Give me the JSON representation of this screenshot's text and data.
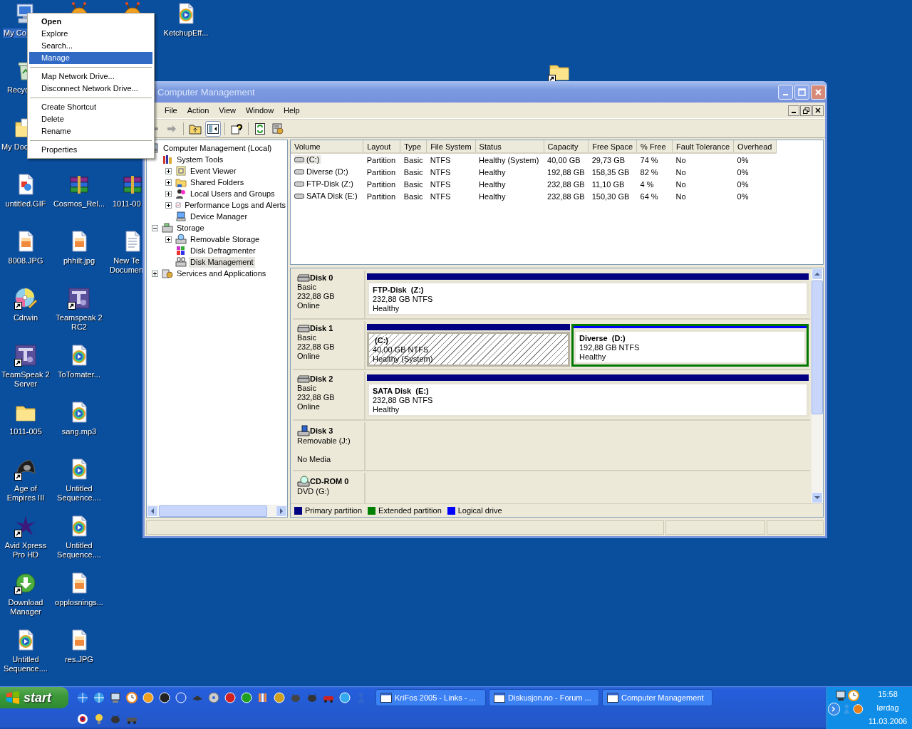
{
  "desktop": {
    "icons": [
      {
        "kind": "computer",
        "label": "My Co",
        "selected": true,
        "shortcut": false
      },
      {
        "kind": "recycle",
        "label": "Recyc",
        "selected": false,
        "shortcut": false
      },
      {
        "kind": "documents",
        "label": "My Doc",
        "selected": false,
        "shortcut": false
      },
      {
        "kind": "gif",
        "label": "untitled.GIF",
        "selected": false,
        "shortcut": false
      },
      {
        "kind": "image",
        "label": "8008.JPG",
        "selected": false,
        "shortcut": false
      },
      {
        "kind": "disc",
        "label": "Cdrwin",
        "selected": false,
        "shortcut": true
      },
      {
        "kind": "ts",
        "label": "TeamSpeak 2 Server",
        "selected": false,
        "shortcut": true
      },
      {
        "kind": "folder",
        "label": "1011-005",
        "selected": false,
        "shortcut": false
      },
      {
        "kind": "game",
        "label": "Age of Empires III",
        "selected": false,
        "shortcut": true
      },
      {
        "kind": "avid",
        "label": "Avid Xpress Pro HD",
        "selected": false,
        "shortcut": true
      },
      {
        "kind": "download",
        "label": "Download Manager",
        "selected": false,
        "shortcut": true
      },
      {
        "kind": "media",
        "label": "Untitled Sequence....",
        "selected": false,
        "shortcut": false
      },
      {
        "kind": "ant",
        "selected": false,
        "shortcut": false
      },
      {
        "kind": "archive",
        "label": "Cosmos_Rel...",
        "selected": false,
        "shortcut": false
      },
      {
        "kind": "image",
        "label": "phhilt.jpg",
        "selected": false,
        "shortcut": false
      },
      {
        "kind": "ts",
        "label": "Teamspeak 2 RC2",
        "selected": false,
        "shortcut": true
      },
      {
        "kind": "media",
        "label": "ToTomater...",
        "selected": false,
        "shortcut": false
      },
      {
        "kind": "media",
        "label": "sang.mp3",
        "selected": false,
        "shortcut": false
      },
      {
        "kind": "media",
        "label": "Untitled Sequence....",
        "selected": false,
        "shortcut": false
      },
      {
        "kind": "media",
        "label": "Untitled Sequence....",
        "selected": false,
        "shortcut": false
      },
      {
        "kind": "image",
        "label": "opplosnings...",
        "selected": false,
        "shortcut": false
      },
      {
        "kind": "image",
        "label": "res.JPG",
        "selected": false,
        "shortcut": false
      },
      {
        "kind": "ant",
        "selected": false,
        "shortcut": false
      },
      {
        "kind": "archive",
        "label": "1011-00",
        "selected": false,
        "shortcut": false
      },
      {
        "kind": "text",
        "label": "New Te\nDocumen",
        "selected": false,
        "shortcut": false
      },
      {
        "kind": "media",
        "label": "KetchupEff...",
        "selected": false,
        "shortcut": false
      },
      {
        "kind": "folder",
        "selected": false,
        "shortcut": true
      }
    ]
  },
  "window": {
    "title": "Computer Management",
    "menu": [
      "File",
      "Action",
      "View",
      "Window",
      "Help"
    ],
    "toolbar": {
      "console_tree_pressed": true
    },
    "tree": [
      {
        "label": "Computer Management (Local)",
        "kind": "computer",
        "selected": false,
        "children": [
          {
            "label": "System Tools",
            "kind": "tools",
            "selected": false,
            "children": [
              {
                "label": "Event Viewer",
                "kind": "log",
                "expanded": false,
                "selected": false
              },
              {
                "label": "Shared Folders",
                "kind": "share",
                "expanded": false,
                "selected": false
              },
              {
                "label": "Local Users and Groups",
                "kind": "users",
                "expanded": false,
                "selected": false
              },
              {
                "label": "Performance Logs and Alerts",
                "kind": "perf",
                "expanded": false,
                "selected": false
              },
              {
                "label": "Device Manager",
                "kind": "device",
                "selected": false
              }
            ]
          },
          {
            "label": "Storage",
            "kind": "storage",
            "expanded": true,
            "selected": false,
            "children": [
              {
                "label": "Removable Storage",
                "kind": "removable",
                "expanded": false,
                "selected": false
              },
              {
                "label": "Disk Defragmenter",
                "kind": "defrag",
                "selected": false
              },
              {
                "label": "Disk Management",
                "kind": "diskmgmt",
                "selected": true
              }
            ]
          },
          {
            "label": "Services and Applications",
            "kind": "services",
            "expanded": false,
            "selected": false
          }
        ]
      }
    ],
    "volumes": {
      "columns": [
        "Volume",
        "Layout",
        "Type",
        "File System",
        "Status",
        "Capacity",
        "Free Space",
        "% Free",
        "Fault Tolerance",
        "Overhead"
      ],
      "rows": [
        {
          "selected": true,
          "cells": [
            "(C:)",
            "Partition",
            "Basic",
            "NTFS",
            "Healthy (System)",
            "40,00 GB",
            "29,73 GB",
            "74 %",
            "No",
            "0%"
          ]
        },
        {
          "selected": false,
          "cells": [
            "Diverse (D:)",
            "Partition",
            "Basic",
            "NTFS",
            "Healthy",
            "192,88 GB",
            "158,35 GB",
            "82 %",
            "No",
            "0%"
          ]
        },
        {
          "selected": false,
          "cells": [
            "FTP-Disk (Z:)",
            "Partition",
            "Basic",
            "NTFS",
            "Healthy",
            "232,88 GB",
            "11,10 GB",
            "4 %",
            "No",
            "0%"
          ]
        },
        {
          "selected": false,
          "cells": [
            "SATA Disk (E:)",
            "Partition",
            "Basic",
            "NTFS",
            "Healthy",
            "232,88 GB",
            "150,30 GB",
            "64 %",
            "No",
            "0%"
          ]
        }
      ]
    },
    "disks": [
      {
        "name": "Disk 0",
        "kind": "fixed",
        "details": [
          "Basic",
          "232,88 GB",
          "Online"
        ],
        "partitions": [
          {
            "name": "FTP-Disk  (Z:)",
            "size": "232,88 GB NTFS",
            "status": "Healthy",
            "kind": "primary",
            "selected": false
          }
        ]
      },
      {
        "name": "Disk 1",
        "kind": "fixed",
        "details": [
          "Basic",
          "232,88 GB",
          "Online"
        ],
        "partitions": [
          {
            "name": " (C:)",
            "size": "40,00 GB NTFS",
            "status": "Healthy (System)",
            "kind": "primary",
            "selected": true
          },
          {
            "name": "Diverse  (D:)",
            "size": "192,88 GB NTFS",
            "status": "Healthy",
            "kind": "logical",
            "selected": false
          }
        ]
      },
      {
        "name": "Disk 2",
        "kind": "fixed",
        "details": [
          "Basic",
          "232,88 GB",
          "Online"
        ],
        "partitions": [
          {
            "name": "SATA Disk  (E:)",
            "size": "232,88 GB NTFS",
            "status": "Healthy",
            "kind": "primary",
            "selected": false
          }
        ]
      },
      {
        "name": "Disk 3",
        "kind": "removable",
        "details": [
          "Removable (J:)",
          "No Media"
        ]
      },
      {
        "name": "CD-ROM 0",
        "kind": "cdrom",
        "details": [
          "DVD (G:)"
        ]
      }
    ],
    "legend": [
      {
        "label": "Primary partition",
        "color": "#000080"
      },
      {
        "label": "Extended partition",
        "color": "#008000"
      },
      {
        "label": "Logical drive",
        "color": "#0000ff"
      }
    ]
  },
  "context_menu": {
    "items": [
      {
        "kind": "item",
        "label": "Open",
        "default": true,
        "selected": false
      },
      {
        "kind": "item",
        "label": "Explore",
        "default": false,
        "selected": false
      },
      {
        "kind": "item",
        "label": "Search...",
        "default": false,
        "selected": false
      },
      {
        "kind": "item",
        "label": "Manage",
        "default": false,
        "selected": true
      },
      {
        "kind": "separator"
      },
      {
        "kind": "item",
        "label": "Map Network Drive...",
        "default": false,
        "selected": false
      },
      {
        "kind": "item",
        "label": "Disconnect Network Drive...",
        "default": false,
        "selected": false
      },
      {
        "kind": "separator"
      },
      {
        "kind": "item",
        "label": "Create Shortcut",
        "default": false,
        "selected": false
      },
      {
        "kind": "item",
        "label": "Delete",
        "default": false,
        "selected": false
      },
      {
        "kind": "item",
        "label": "Rename",
        "default": false,
        "selected": false
      },
      {
        "kind": "separator"
      },
      {
        "kind": "item",
        "label": "Properties",
        "default": false,
        "selected": false
      }
    ]
  },
  "taskbar": {
    "start": "start",
    "tasks": [
      {
        "label": "KriFos 2005 - Links - ...",
        "selected": false
      },
      {
        "label": "Diskusjon.no - Forum ...",
        "selected": false
      },
      {
        "label": "Computer Management",
        "selected": false
      }
    ],
    "clock": {
      "time": "15:58",
      "day": "lørdag",
      "date": "11.03.2006"
    }
  }
}
